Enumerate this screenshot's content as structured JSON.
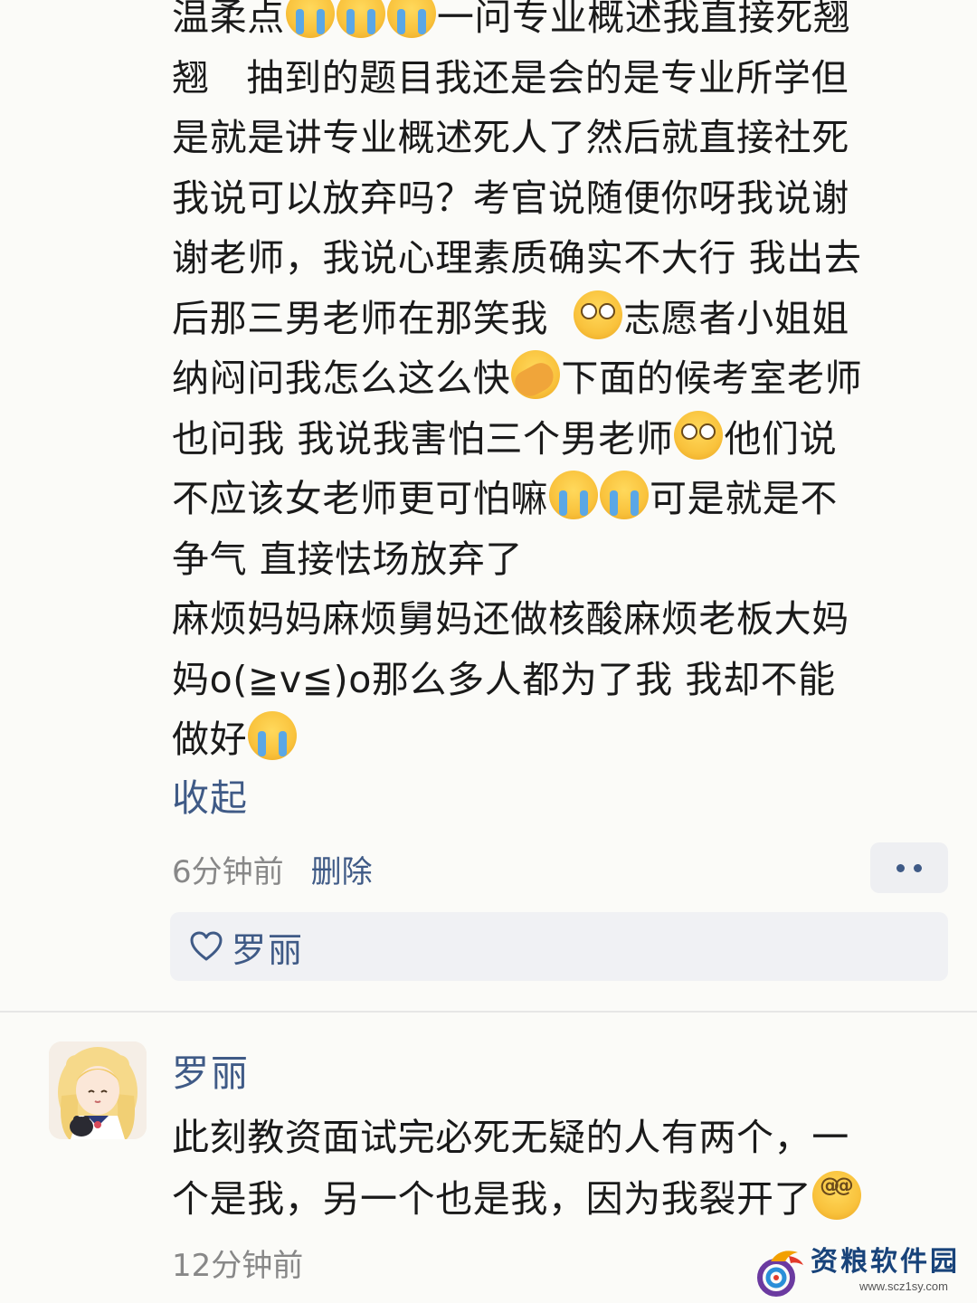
{
  "post": {
    "lines": [
      [
        "温柔点",
        {
          "emoji": "loudly-crying-face"
        },
        {
          "emoji": "loudly-crying-face"
        },
        {
          "emoji": "loudly-crying-face"
        },
        "一问专业概述我直接死翘"
      ],
      [
        "翘   抽到的题目我还是会的是专业所学但"
      ],
      [
        "是就是讲专业概述死人了然后就直接社死"
      ],
      [
        "我说可以放弃吗？考官说随便你呀我说谢"
      ],
      [
        "谢老师，我说心理素质确实不大行 我出去"
      ],
      [
        "后那三男老师在那笑我  ",
        {
          "emoji": "crying-face"
        },
        "志愿者小姐姐"
      ],
      [
        "纳闷问我怎么这么快",
        {
          "emoji": "face-palm"
        },
        "下面的候考室老师"
      ],
      [
        "也问我 我说我害怕三个男老师",
        {
          "emoji": "crying-face"
        },
        "他们说"
      ],
      [
        "不应该女老师更可怕嘛",
        {
          "emoji": "loudly-crying-face"
        },
        {
          "emoji": "loudly-crying-face"
        },
        "可是就是不"
      ],
      [
        "争气 直接怯场放弃了"
      ],
      [
        "麻烦妈妈麻烦舅妈还做核酸麻烦老板大妈"
      ],
      [
        "妈o(≧v≦)o那么多人都为了我 我却不能"
      ],
      [
        "做好",
        {
          "emoji": "loudly-crying-face"
        }
      ]
    ],
    "collapse_label": "收起",
    "time": "6分钟前",
    "delete_label": "删除",
    "more_icon": "more-dots-icon",
    "likes": {
      "icon": "heart-icon",
      "names": "罗丽"
    }
  },
  "comment": {
    "author": "罗丽",
    "avatar_icon": "anime-girl-avatar",
    "lines": [
      [
        "此刻教资面试完必死无疑的人有两个，一"
      ],
      [
        "个是我，另一个也是我，因为我裂开了",
        {
          "emoji": "dizzy-face"
        }
      ]
    ],
    "time": "12分钟前"
  },
  "watermark": {
    "text": "资粮软件园",
    "url": "www.scz1sy.com"
  },
  "colors": {
    "link": "#3f5a86",
    "meta": "#888888",
    "text": "#1a1a1a",
    "background": "#fbfbf8"
  }
}
